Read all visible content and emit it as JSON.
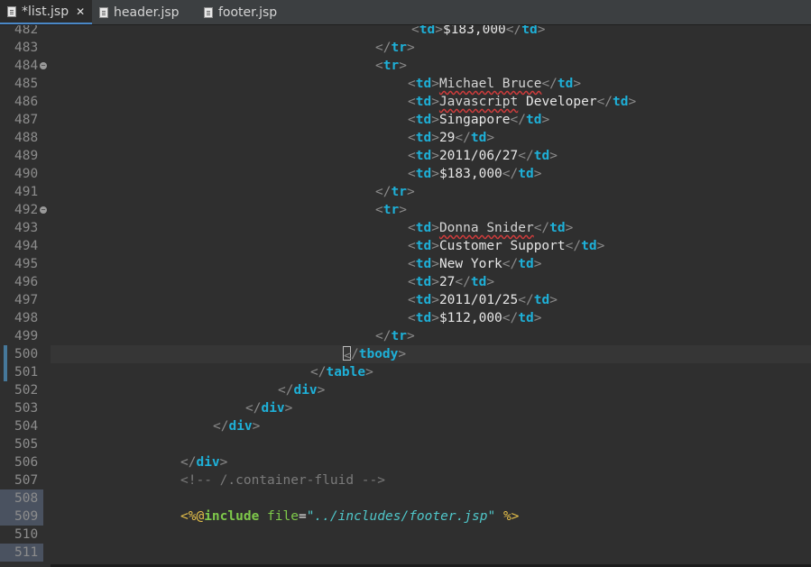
{
  "tabs": [
    {
      "label": "*list.jsp",
      "active": true,
      "closable": true
    },
    {
      "label": "header.jsp",
      "active": false,
      "closable": false
    },
    {
      "label": "footer.jsp",
      "active": false,
      "closable": false
    }
  ],
  "close_glyph": "✕",
  "current_line": 500,
  "colors": {
    "tag": "#1eb0d8",
    "bracket": "#8a8a8a",
    "comment": "#7a7a7a",
    "directive": "#e6c04a",
    "keyword": "#7ec94a",
    "value": "#4fc6c9",
    "background": "#2f2f2f"
  },
  "lines": [
    {
      "num": "482",
      "indent": 400,
      "tokens": [
        [
          "b",
          "<"
        ],
        [
          "t",
          "td"
        ],
        [
          "b",
          ">"
        ],
        [
          "txt",
          "$183,000"
        ],
        [
          "b",
          "</"
        ],
        [
          "t",
          "td"
        ],
        [
          "b",
          ">"
        ]
      ]
    },
    {
      "num": "483",
      "indent": 360,
      "tokens": [
        [
          "b",
          "</"
        ],
        [
          "t",
          "tr"
        ],
        [
          "b",
          ">"
        ]
      ]
    },
    {
      "num": "484",
      "indent": 360,
      "fold": true,
      "tokens": [
        [
          "b",
          "<"
        ],
        [
          "t",
          "tr"
        ],
        [
          "b",
          ">"
        ]
      ]
    },
    {
      "num": "485",
      "indent": 396,
      "tokens": [
        [
          "b",
          "<"
        ],
        [
          "t",
          "td"
        ],
        [
          "b",
          ">"
        ],
        [
          "sq",
          "Michael Bruce"
        ],
        [
          "b",
          "</"
        ],
        [
          "t",
          "td"
        ],
        [
          "b",
          ">"
        ]
      ]
    },
    {
      "num": "486",
      "indent": 396,
      "tokens": [
        [
          "b",
          "<"
        ],
        [
          "t",
          "td"
        ],
        [
          "b",
          ">"
        ],
        [
          "sq",
          "Javascript"
        ],
        [
          "txt",
          " Developer"
        ],
        [
          "b",
          "</"
        ],
        [
          "t",
          "td"
        ],
        [
          "b",
          ">"
        ]
      ]
    },
    {
      "num": "487",
      "indent": 396,
      "tokens": [
        [
          "b",
          "<"
        ],
        [
          "t",
          "td"
        ],
        [
          "b",
          ">"
        ],
        [
          "txt",
          "Singapore"
        ],
        [
          "b",
          "</"
        ],
        [
          "t",
          "td"
        ],
        [
          "b",
          ">"
        ]
      ]
    },
    {
      "num": "488",
      "indent": 396,
      "tokens": [
        [
          "b",
          "<"
        ],
        [
          "t",
          "td"
        ],
        [
          "b",
          ">"
        ],
        [
          "txt",
          "29"
        ],
        [
          "b",
          "</"
        ],
        [
          "t",
          "td"
        ],
        [
          "b",
          ">"
        ]
      ]
    },
    {
      "num": "489",
      "indent": 396,
      "tokens": [
        [
          "b",
          "<"
        ],
        [
          "t",
          "td"
        ],
        [
          "b",
          ">"
        ],
        [
          "txt",
          "2011/06/27"
        ],
        [
          "b",
          "</"
        ],
        [
          "t",
          "td"
        ],
        [
          "b",
          ">"
        ]
      ]
    },
    {
      "num": "490",
      "indent": 396,
      "tokens": [
        [
          "b",
          "<"
        ],
        [
          "t",
          "td"
        ],
        [
          "b",
          ">"
        ],
        [
          "txt",
          "$183,000"
        ],
        [
          "b",
          "</"
        ],
        [
          "t",
          "td"
        ],
        [
          "b",
          ">"
        ]
      ]
    },
    {
      "num": "491",
      "indent": 360,
      "tokens": [
        [
          "b",
          "</"
        ],
        [
          "t",
          "tr"
        ],
        [
          "b",
          ">"
        ]
      ]
    },
    {
      "num": "492",
      "indent": 360,
      "fold": true,
      "tokens": [
        [
          "b",
          "<"
        ],
        [
          "t",
          "tr"
        ],
        [
          "b",
          ">"
        ]
      ]
    },
    {
      "num": "493",
      "indent": 396,
      "tokens": [
        [
          "b",
          "<"
        ],
        [
          "t",
          "td"
        ],
        [
          "b",
          ">"
        ],
        [
          "sq",
          "Donna Snider"
        ],
        [
          "b",
          "</"
        ],
        [
          "t",
          "td"
        ],
        [
          "b",
          ">"
        ]
      ]
    },
    {
      "num": "494",
      "indent": 396,
      "tokens": [
        [
          "b",
          "<"
        ],
        [
          "t",
          "td"
        ],
        [
          "b",
          ">"
        ],
        [
          "txt",
          "Customer Support"
        ],
        [
          "b",
          "</"
        ],
        [
          "t",
          "td"
        ],
        [
          "b",
          ">"
        ]
      ]
    },
    {
      "num": "495",
      "indent": 396,
      "tokens": [
        [
          "b",
          "<"
        ],
        [
          "t",
          "td"
        ],
        [
          "b",
          ">"
        ],
        [
          "txt",
          "New York"
        ],
        [
          "b",
          "</"
        ],
        [
          "t",
          "td"
        ],
        [
          "b",
          ">"
        ]
      ]
    },
    {
      "num": "496",
      "indent": 396,
      "tokens": [
        [
          "b",
          "<"
        ],
        [
          "t",
          "td"
        ],
        [
          "b",
          ">"
        ],
        [
          "txt",
          "27"
        ],
        [
          "b",
          "</"
        ],
        [
          "t",
          "td"
        ],
        [
          "b",
          ">"
        ]
      ]
    },
    {
      "num": "497",
      "indent": 396,
      "tokens": [
        [
          "b",
          "<"
        ],
        [
          "t",
          "td"
        ],
        [
          "b",
          ">"
        ],
        [
          "txt",
          "2011/01/25"
        ],
        [
          "b",
          "</"
        ],
        [
          "t",
          "td"
        ],
        [
          "b",
          ">"
        ]
      ]
    },
    {
      "num": "498",
      "indent": 396,
      "tokens": [
        [
          "b",
          "<"
        ],
        [
          "t",
          "td"
        ],
        [
          "b",
          ">"
        ],
        [
          "txt",
          "$112,000"
        ],
        [
          "b",
          "</"
        ],
        [
          "t",
          "td"
        ],
        [
          "b",
          ">"
        ]
      ]
    },
    {
      "num": "499",
      "indent": 360,
      "tokens": [
        [
          "b",
          "</"
        ],
        [
          "t",
          "tr"
        ],
        [
          "b",
          ">"
        ]
      ]
    },
    {
      "num": "500",
      "indent": 324,
      "mark": true,
      "tokens": [
        [
          "caret",
          "<"
        ],
        [
          "b",
          "/"
        ],
        [
          "t",
          "tbody"
        ],
        [
          "b",
          ">"
        ]
      ]
    },
    {
      "num": "501",
      "indent": 288,
      "mark": true,
      "tokens": [
        [
          "b",
          "</"
        ],
        [
          "t",
          "table"
        ],
        [
          "b",
          ">"
        ]
      ]
    },
    {
      "num": "502",
      "indent": 252,
      "tokens": [
        [
          "b",
          "</"
        ],
        [
          "t",
          "div"
        ],
        [
          "b",
          ">"
        ]
      ]
    },
    {
      "num": "503",
      "indent": 216,
      "tokens": [
        [
          "b",
          "</"
        ],
        [
          "t",
          "div"
        ],
        [
          "b",
          ">"
        ]
      ]
    },
    {
      "num": "504",
      "indent": 180,
      "tokens": [
        [
          "b",
          "</"
        ],
        [
          "t",
          "div"
        ],
        [
          "b",
          ">"
        ]
      ]
    },
    {
      "num": "505",
      "indent": 0,
      "tokens": []
    },
    {
      "num": "506",
      "indent": 144,
      "tokens": [
        [
          "b",
          "</"
        ],
        [
          "t",
          "div"
        ],
        [
          "b",
          ">"
        ]
      ]
    },
    {
      "num": "507",
      "indent": 144,
      "tokens": [
        [
          "c",
          "<!-- /.container-fluid -->"
        ]
      ]
    },
    {
      "num": "508",
      "indent": 0,
      "hl": true,
      "tokens": []
    },
    {
      "num": "509",
      "indent": 144,
      "hl": true,
      "tokens": [
        [
          "d",
          "<%@"
        ],
        [
          "k",
          "include"
        ],
        [
          "txt",
          " "
        ],
        [
          "a",
          "file"
        ],
        [
          "txt",
          "="
        ],
        [
          "v",
          "\"../includes/footer.jsp\""
        ],
        [
          "txt",
          " "
        ],
        [
          "d",
          "%>"
        ]
      ]
    },
    {
      "num": "510",
      "indent": 0,
      "tokens": []
    },
    {
      "num": "511",
      "indent": 0,
      "hl": true,
      "tokens": []
    }
  ]
}
